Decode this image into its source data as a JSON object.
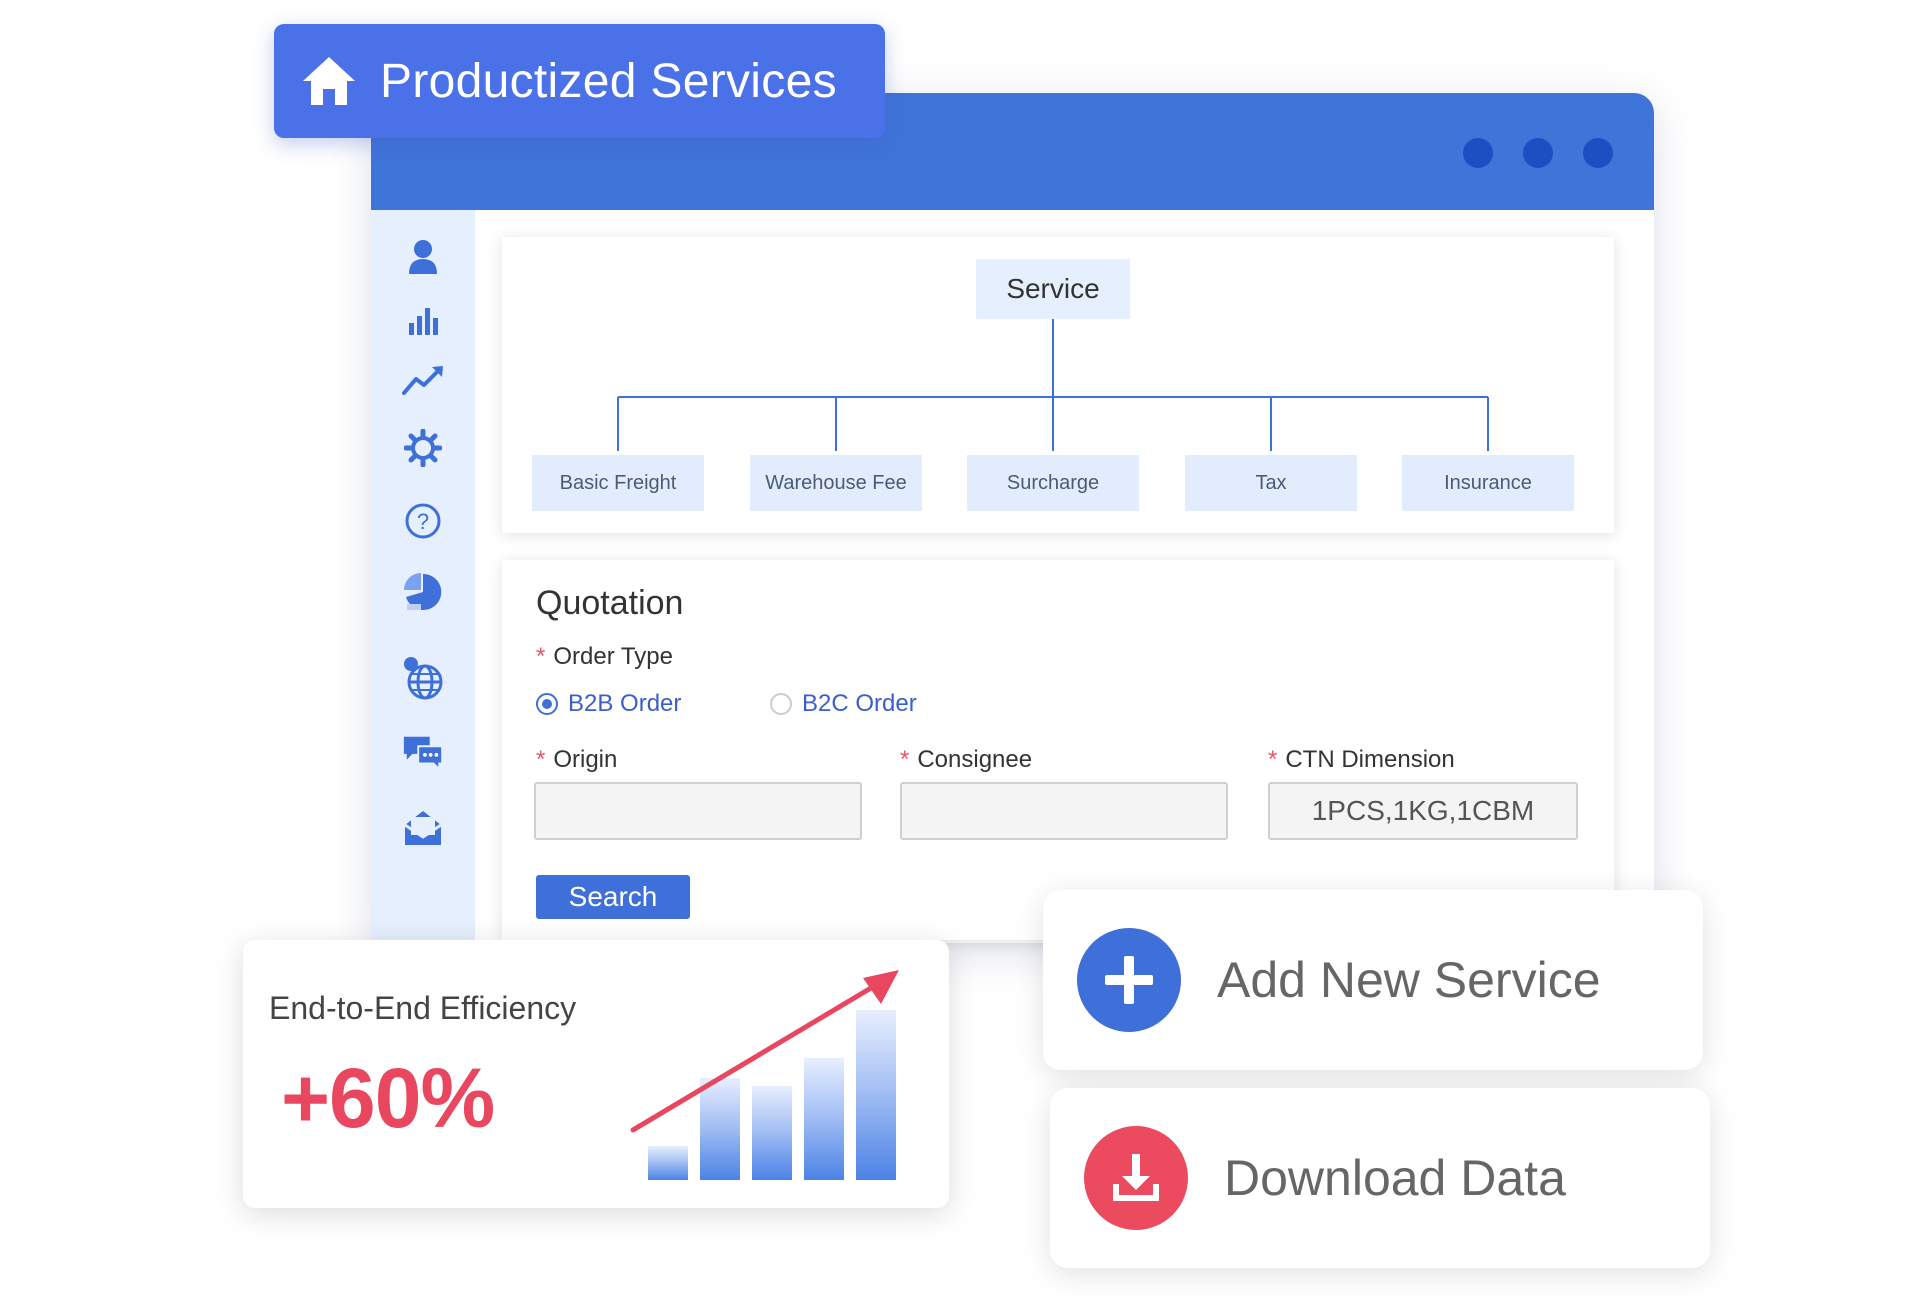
{
  "header": {
    "title": "Productized Services",
    "icon": "home-icon"
  },
  "window": {
    "dots": [
      "dot",
      "dot",
      "dot"
    ],
    "titlebar_color": "#3f74d8",
    "dot_color": "#1e4fc2"
  },
  "sidebar": {
    "icons": [
      "user-icon",
      "bar-chart-icon",
      "trend-icon",
      "gear-icon",
      "help-icon",
      "pie-chart-icon",
      "globe-icon",
      "chat-icon",
      "mail-icon"
    ]
  },
  "service_tree": {
    "root": "Service",
    "children": [
      "Basic Freight",
      "Warehouse Fee",
      "Surcharge",
      "Tax",
      "Insurance"
    ]
  },
  "quotation": {
    "title": "Quotation",
    "required_mark": "*",
    "order_type_label": "Order Type",
    "options": [
      {
        "label": "B2B Order",
        "selected": true
      },
      {
        "label": "B2C Order",
        "selected": false
      }
    ],
    "fields": [
      {
        "label": "Origin",
        "value": ""
      },
      {
        "label": "Consignee",
        "value": ""
      },
      {
        "label": "CTN Dimension",
        "value": "1PCS,1KG,1CBM"
      }
    ],
    "search_label": "Search"
  },
  "efficiency": {
    "label": "End-to-End Efficiency",
    "value": "+60%",
    "bar_levels": [
      0.2,
      0.6,
      0.55,
      0.72,
      1.0
    ],
    "accent": "#e8475f"
  },
  "actions": {
    "add": {
      "label": "Add New Service",
      "color": "#3f6fd8",
      "icon": "plus-icon"
    },
    "download": {
      "label": "Download Data",
      "color": "#ec4a5e",
      "icon": "download-icon"
    }
  }
}
